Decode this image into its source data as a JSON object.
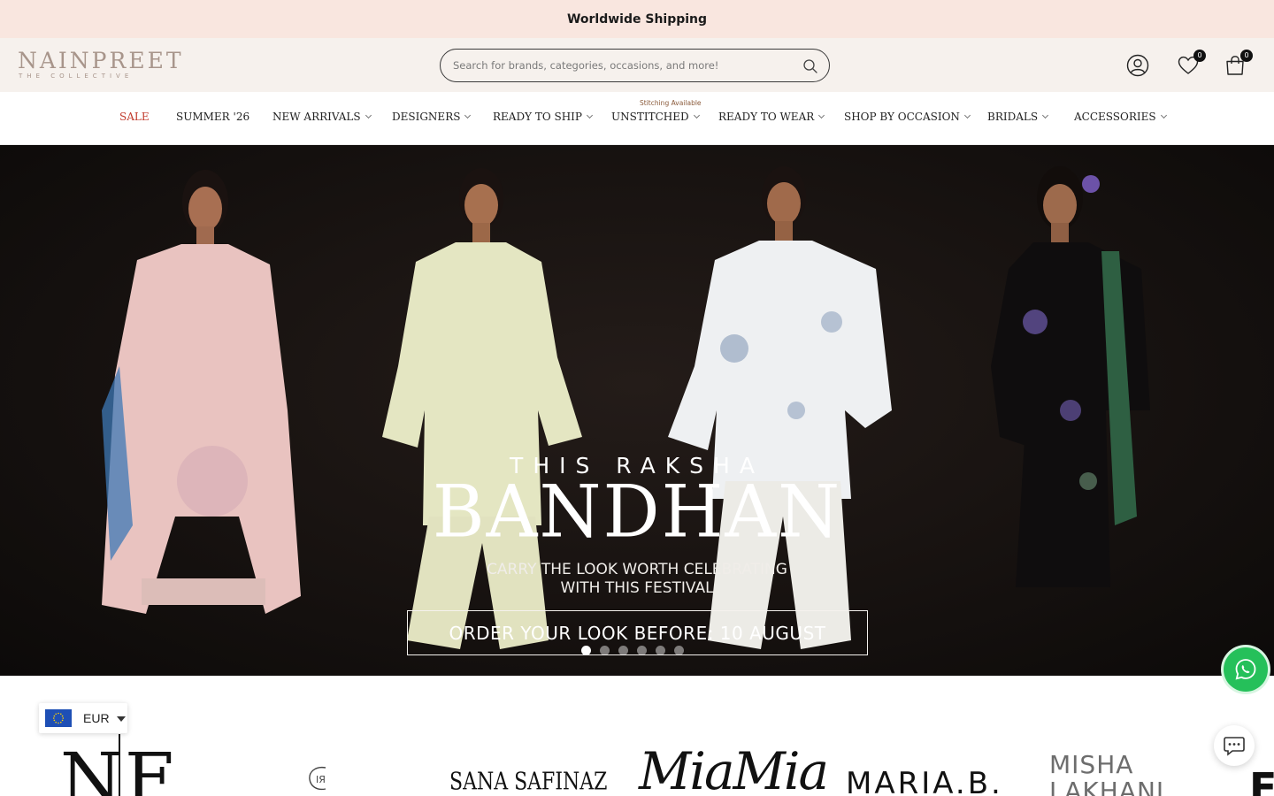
{
  "announcement": {
    "text": "Worldwide Shipping"
  },
  "header": {
    "logo": {
      "name": "NAINPREET",
      "tagline": "THE COLLECTIVE"
    },
    "search": {
      "placeholder": "Search for brands, categories, occasions, and more!",
      "icon": "search-icon"
    },
    "icons": [
      {
        "name": "account-icon"
      },
      {
        "name": "wishlist-heart-icon",
        "count": "0"
      },
      {
        "name": "cart-bag-icon",
        "count": "0"
      }
    ]
  },
  "nav": {
    "note": "Stitching Available",
    "items": [
      {
        "label": "SALE",
        "dropdown": false
      },
      {
        "label": "SUMMER '26",
        "dropdown": false
      },
      {
        "label": "NEW ARRIVALS",
        "dropdown": true
      },
      {
        "label": "DESIGNERS",
        "dropdown": true
      },
      {
        "label": "READY TO SHIP",
        "dropdown": true
      },
      {
        "label": "UNSTITCHED",
        "dropdown": true
      },
      {
        "label": "READY TO WEAR",
        "dropdown": true
      },
      {
        "label": "SHOP BY OCCASION",
        "dropdown": true
      },
      {
        "label": "BRIDALS",
        "dropdown": true
      },
      {
        "label": "ACCESSORIES",
        "dropdown": true
      }
    ],
    "sale_color": "#c0392b"
  },
  "hero": {
    "kicker": "THIS RAKSHA",
    "title": "BANDHAN",
    "subtitle_line1": "CARRY THE LOOK WORTH CELEBRATING",
    "subtitle_line2": "WITH THIS FESTIVAL",
    "cta": "ORDER YOUR LOOK BEFORE: 10 AUGUST",
    "slides": 6,
    "active_slide": 1
  },
  "floating": {
    "whatsapp": {
      "icon": "whatsapp-icon",
      "color": "#25c05a"
    },
    "chat": {
      "icon": "chat-bubble-icon"
    }
  },
  "currency": {
    "code": "EUR",
    "flag": "eu-flag-icon"
  },
  "brands": [
    {
      "name": "NF"
    },
    {
      "name": "logo-mark"
    },
    {
      "name": "SANA SAFINAZ"
    },
    {
      "name": "MiaMia"
    },
    {
      "name": "MARIA.B."
    },
    {
      "name": "MISHA LAKHANI"
    },
    {
      "name": "F"
    }
  ],
  "colors": {
    "announcement_bg": "#f9e6df",
    "header_bg": "#f6f1ed",
    "logo": "#a8958b"
  }
}
